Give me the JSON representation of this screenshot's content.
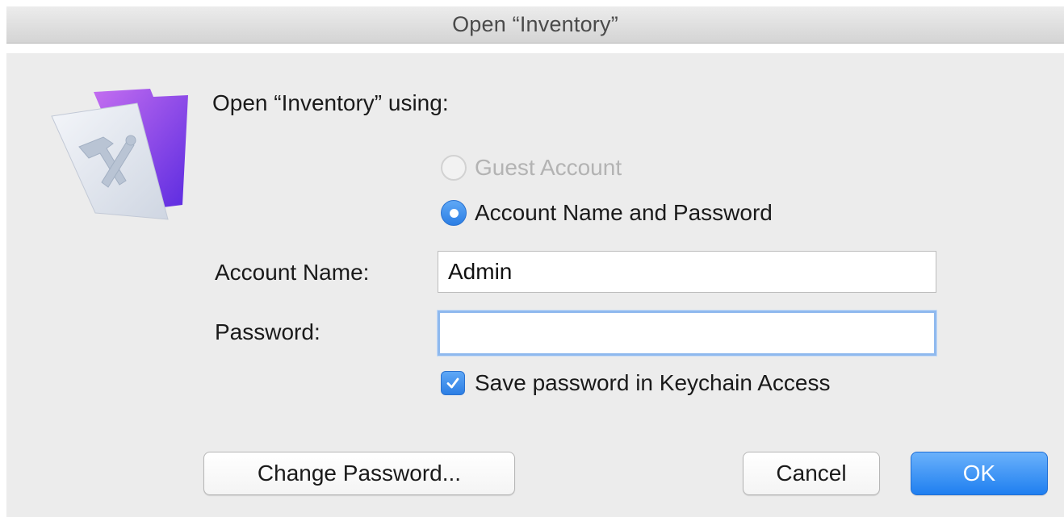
{
  "window": {
    "title": "Open “Inventory”"
  },
  "dialog": {
    "prompt": "Open “Inventory” using:",
    "options": {
      "guest_label": "Guest Account",
      "guest_enabled": false,
      "account_label": "Account Name and Password",
      "selected": "account"
    },
    "account_name": {
      "label": "Account Name:",
      "value": "Admin"
    },
    "password": {
      "label": "Password:",
      "value": ""
    },
    "keychain": {
      "label": "Save password in Keychain Access",
      "checked": true
    },
    "buttons": {
      "change_password": "Change Password...",
      "cancel": "Cancel",
      "ok": "OK"
    },
    "icon": "filemaker-app-icon",
    "accent_color": "#2c7ee4"
  }
}
